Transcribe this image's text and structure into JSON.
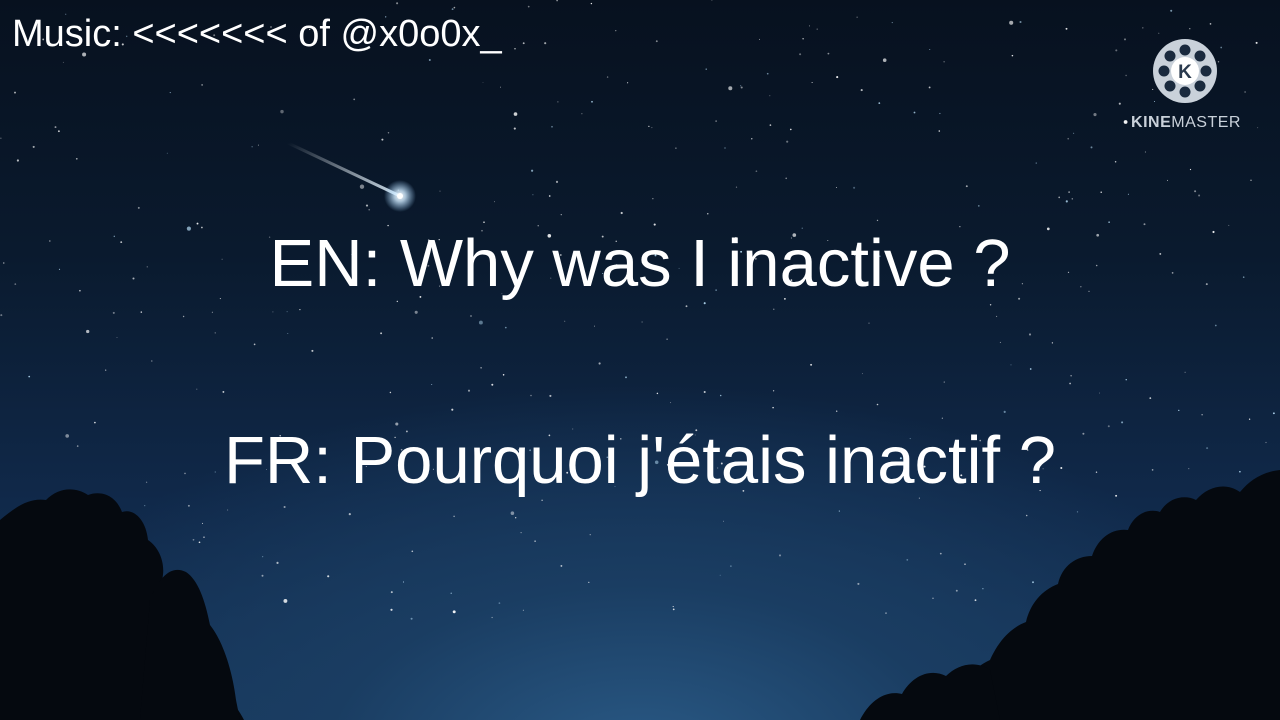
{
  "overlay": {
    "credit": "Music: <<<<<<< of @x0o0x_",
    "line_en": "EN: Why was I inactive ?",
    "line_fr": "FR: Pourquoi j'étais inactif ?"
  },
  "watermark": {
    "brand_part1": "KINE",
    "brand_part2": "MASTER",
    "logo_letter": "K",
    "icon": "film-reel-icon"
  },
  "colors": {
    "text": "#ffffff",
    "sky_top": "#07111f",
    "sky_bottom": "#17375c",
    "trees": "#05090f",
    "watermark": "#c9d1da"
  }
}
